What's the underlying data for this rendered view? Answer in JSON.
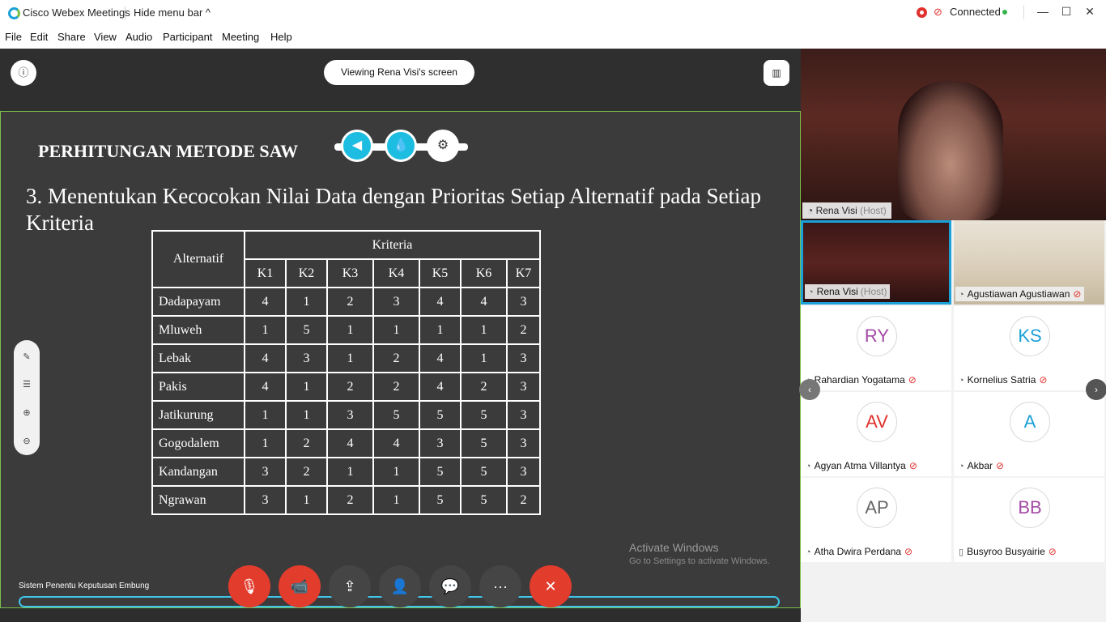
{
  "titlebar": {
    "app_title": "Cisco Webex Meetings",
    "hide_menu": "Hide menu bar ^",
    "status": "Connected",
    "minimize": "—",
    "maximize": "☐",
    "close": "✕"
  },
  "menu": [
    "File",
    "Edit",
    "Share",
    "View",
    "Audio",
    "Participant",
    "Meeting",
    "Help"
  ],
  "stage": {
    "viewing": "Viewing Rena Visi's screen",
    "info_icon": "ⓘ",
    "layout_icon": "▥"
  },
  "slide": {
    "title": "PERHITUNGAN METODE SAW",
    "subtitle": "3. Menentukan Kecocokan Nilai Data dengan Prioritas Setiap Alternatif pada Setiap Kriteria",
    "badges": [
      "◀",
      "💧",
      "⚙"
    ],
    "table": {
      "alt_header": "Alternatif",
      "group_header": "Kriteria",
      "columns": [
        "K1",
        "K2",
        "K3",
        "K4",
        "K5",
        "K6",
        "K7"
      ],
      "rows": [
        {
          "name": "Dadapayam",
          "values": [
            "4",
            "1",
            "2",
            "3",
            "4",
            "4",
            "3"
          ]
        },
        {
          "name": "Mluweh",
          "values": [
            "1",
            "5",
            "1",
            "1",
            "1",
            "1",
            "2"
          ]
        },
        {
          "name": "Lebak",
          "values": [
            "4",
            "3",
            "1",
            "2",
            "4",
            "1",
            "3"
          ]
        },
        {
          "name": "Pakis",
          "values": [
            "4",
            "1",
            "2",
            "2",
            "4",
            "2",
            "3"
          ]
        },
        {
          "name": "Jatikurung",
          "values": [
            "1",
            "1",
            "3",
            "5",
            "5",
            "5",
            "3"
          ]
        },
        {
          "name": "Gogodalem",
          "values": [
            "1",
            "2",
            "4",
            "4",
            "3",
            "5",
            "3"
          ]
        },
        {
          "name": "Kandangan",
          "values": [
            "3",
            "2",
            "1",
            "1",
            "5",
            "5",
            "3"
          ]
        },
        {
          "name": "Ngrawan",
          "values": [
            "3",
            "1",
            "2",
            "1",
            "5",
            "5",
            "2"
          ]
        }
      ]
    },
    "watermark_title": "Activate Windows",
    "watermark_sub": "Go to Settings to activate Windows.",
    "footer": "Sistem Penentu Keputusan Embung",
    "progress": 1.0
  },
  "tools": [
    "✎",
    "☰",
    "⊕",
    "⊖"
  ],
  "controls": {
    "mute": "🎙",
    "video": "📹",
    "share": "⇪",
    "participants": "👤",
    "chat": "💬",
    "more": "···",
    "leave": "✕"
  },
  "participants_panel": {
    "main_name": "Rena Visi",
    "main_host": "(Host)",
    "tiles": [
      {
        "name": "Rena Visi",
        "host": "(Host)",
        "initials": "",
        "color": "",
        "video": true
      },
      {
        "name": "Agustiawan Agustiawan",
        "host": "",
        "initials": "",
        "color": "",
        "video": true
      },
      {
        "name": "Rahardian Yogatama",
        "host": "",
        "initials": "RY",
        "color": "#a349a4",
        "video": false
      },
      {
        "name": "Kornelius Satria",
        "host": "",
        "initials": "KS",
        "color": "#1a9fd6",
        "video": false
      },
      {
        "name": "Agyan Atma Villantya",
        "host": "",
        "initials": "AV",
        "color": "#e0312c",
        "video": false
      },
      {
        "name": "Akbar",
        "host": "",
        "initials": "A",
        "color": "#1a9fd6",
        "video": false
      },
      {
        "name": "Atha Dwira Perdana",
        "host": "",
        "initials": "AP",
        "color": "#666666",
        "video": false
      },
      {
        "name": "Busyroo Busyairie",
        "host": "",
        "initials": "BB",
        "color": "#a349a4",
        "video": false
      }
    ],
    "scroll_right": "›",
    "scroll_left": "‹"
  }
}
